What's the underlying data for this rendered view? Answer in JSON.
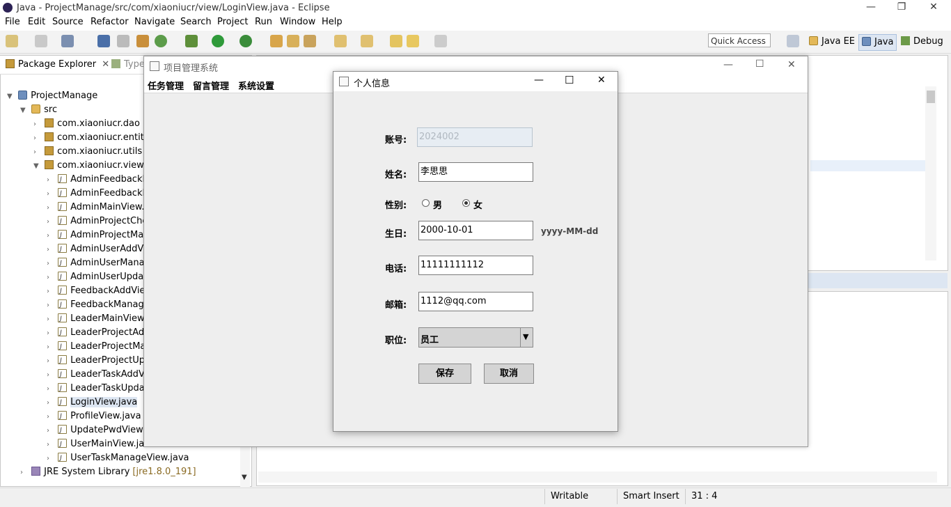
{
  "window": {
    "title": "Java - ProjectManage/src/com/xiaoniucr/view/LoginView.java - Eclipse",
    "minimize": "—",
    "maximize": "❐",
    "close": "✕"
  },
  "menubar": [
    "File",
    "Edit",
    "Source",
    "Refactor",
    "Navigate",
    "Search",
    "Project",
    "Run",
    "Window",
    "Help"
  ],
  "toolbar": {
    "quick_access_placeholder": "Quick Access",
    "perspectives": [
      "Java EE",
      "Java",
      "Debug"
    ]
  },
  "package_explorer": {
    "tab_label": "Package Explorer",
    "second_tab": "Type",
    "project": "ProjectManage",
    "src": "src",
    "packages": [
      "com.xiaoniucr.dao",
      "com.xiaoniucr.entity",
      "com.xiaoniucr.utils",
      "com.xiaoniucr.view"
    ],
    "files": [
      "AdminFeedbackM",
      "AdminFeedbackR",
      "AdminMainView.j",
      "AdminProjectChe",
      "AdminProjectMar",
      "AdminUserAddVi",
      "AdminUserManag",
      "AdminUserUpdat",
      "FeedbackAddView",
      "FeedbackManage",
      "LeaderMainView.j",
      "LeaderProjectAdd",
      "LeaderProjectMa",
      "LeaderProjectUpd",
      "LeaderTaskAddVi",
      "LeaderTaskUpda",
      "LoginView.java",
      "ProfileView.java",
      "UpdatePwdView.j",
      "UserMainView.java",
      "UserTaskManageView.java"
    ],
    "selected_file": "LoginView.java",
    "jre_label": "JRE System Library",
    "jre_version": "[jre1.8.0_191]"
  },
  "status_bar": {
    "writable": "Writable",
    "insert_mode": "Smart Insert",
    "position": "31 : 4"
  },
  "pm_window": {
    "title": "项目管理系统",
    "menus": [
      "任务管理",
      "留言管理",
      "系统设置"
    ]
  },
  "dialog": {
    "title": "个人信息",
    "account_label": "账号:",
    "account_value": "2024002",
    "name_label": "姓名:",
    "name_value": "李思思",
    "gender_label": "性别:",
    "gender_male": "男",
    "gender_female": "女",
    "gender_selected": "female",
    "birthday_label": "生日:",
    "birthday_value": "2000-10-01",
    "birthday_hint": "yyyy-MM-dd",
    "phone_label": "电话:",
    "phone_value": "11111111112",
    "email_label": "邮箱:",
    "email_value": "1112@qq.com",
    "position_label": "职位:",
    "position_value": "员工",
    "save_button": "保存",
    "cancel_button": "取消",
    "minimize": "—",
    "maximize": "☐",
    "close": "✕"
  },
  "colors": {
    "selection": "#dde6f2",
    "accent": "#3a6fb5"
  }
}
